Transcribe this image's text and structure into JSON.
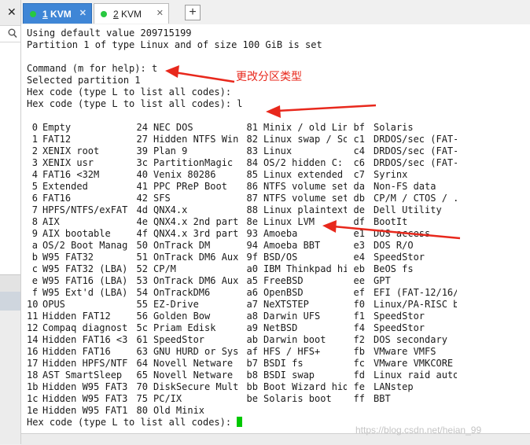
{
  "left_panel": {
    "close_glyph": "✕"
  },
  "tabs": [
    {
      "number": "1",
      "name": "KVM",
      "close_glyph": "✕"
    },
    {
      "number": "2",
      "name": "KVM",
      "close_glyph": "✕"
    }
  ],
  "add_tab_glyph": "+",
  "colors": {
    "active_tab": "#3f86d6",
    "status_dot": "#28c840",
    "cursor": "#00c800",
    "annotation": "#e8281c"
  },
  "terminal": {
    "header_lines": [
      "Using default value 209715199",
      "Partition 1 of type Linux and of size 100 GiB is set",
      "",
      "Command (m for help): t",
      "Selected partition 1",
      "Hex code (type L to list all codes):",
      "Hex code (type L to list all codes): l"
    ],
    "partition_types": [
      [
        "0",
        "Empty",
        "24",
        "NEC DOS",
        "81",
        "Minix / old Lin",
        "bf",
        "Solaris"
      ],
      [
        "1",
        "FAT12",
        "27",
        "Hidden NTFS Win",
        "82",
        "Linux swap / So",
        "c1",
        "DRDOS/sec (FAT-"
      ],
      [
        "2",
        "XENIX root",
        "39",
        "Plan 9",
        "83",
        "Linux",
        "c4",
        "DRDOS/sec (FAT-"
      ],
      [
        "3",
        "XENIX usr",
        "3c",
        "PartitionMagic",
        "84",
        "OS/2 hidden C:",
        "c6",
        "DRDOS/sec (FAT-"
      ],
      [
        "4",
        "FAT16 <32M",
        "40",
        "Venix 80286",
        "85",
        "Linux extended",
        "c7",
        "Syrinx"
      ],
      [
        "5",
        "Extended",
        "41",
        "PPC PReP Boot",
        "86",
        "NTFS volume set",
        "da",
        "Non-FS data"
      ],
      [
        "6",
        "FAT16",
        "42",
        "SFS",
        "87",
        "NTFS volume set",
        "db",
        "CP/M / CTOS / ."
      ],
      [
        "7",
        "HPFS/NTFS/exFAT",
        "4d",
        "QNX4.x",
        "88",
        "Linux plaintext",
        "de",
        "Dell Utility"
      ],
      [
        "8",
        "AIX",
        "4e",
        "QNX4.x 2nd part",
        "8e",
        "Linux LVM",
        "df",
        "BootIt"
      ],
      [
        "9",
        "AIX bootable",
        "4f",
        "QNX4.x 3rd part",
        "93",
        "Amoeba",
        "e1",
        "DOS access"
      ],
      [
        "a",
        "OS/2 Boot Manag",
        "50",
        "OnTrack DM",
        "94",
        "Amoeba BBT",
        "e3",
        "DOS R/O"
      ],
      [
        "b",
        "W95 FAT32",
        "51",
        "OnTrack DM6 Aux",
        "9f",
        "BSD/OS",
        "e4",
        "SpeedStor"
      ],
      [
        "c",
        "W95 FAT32 (LBA)",
        "52",
        "CP/M",
        "a0",
        "IBM Thinkpad hi",
        "eb",
        "BeOS fs"
      ],
      [
        "e",
        "W95 FAT16 (LBA)",
        "53",
        "OnTrack DM6 Aux",
        "a5",
        "FreeBSD",
        "ee",
        "GPT"
      ],
      [
        "f",
        "W95 Ext'd (LBA)",
        "54",
        "OnTrackDM6",
        "a6",
        "OpenBSD",
        "ef",
        "EFI (FAT-12/16/"
      ],
      [
        "10",
        "OPUS",
        "55",
        "EZ-Drive",
        "a7",
        "NeXTSTEP",
        "f0",
        "Linux/PA-RISC b"
      ],
      [
        "11",
        "Hidden FAT12",
        "56",
        "Golden Bow",
        "a8",
        "Darwin UFS",
        "f1",
        "SpeedStor"
      ],
      [
        "12",
        "Compaq diagnost",
        "5c",
        "Priam Edisk",
        "a9",
        "NetBSD",
        "f4",
        "SpeedStor"
      ],
      [
        "14",
        "Hidden FAT16 <3",
        "61",
        "SpeedStor",
        "ab",
        "Darwin boot",
        "f2",
        "DOS secondary"
      ],
      [
        "16",
        "Hidden FAT16",
        "63",
        "GNU HURD or Sys",
        "af",
        "HFS / HFS+",
        "fb",
        "VMware VMFS"
      ],
      [
        "17",
        "Hidden HPFS/NTF",
        "64",
        "Novell Netware",
        "b7",
        "BSDI fs",
        "fc",
        "VMware VMKCORE"
      ],
      [
        "18",
        "AST SmartSleep",
        "65",
        "Novell Netware",
        "b8",
        "BSDI swap",
        "fd",
        "Linux raid auto"
      ],
      [
        "1b",
        "Hidden W95 FAT3",
        "70",
        "DiskSecure Mult",
        "bb",
        "Boot Wizard hid",
        "fe",
        "LANstep"
      ],
      [
        "1c",
        "Hidden W95 FAT3",
        "75",
        "PC/IX",
        "be",
        "Solaris boot",
        "ff",
        "BBT"
      ],
      [
        "1e",
        "Hidden W95 FAT1",
        "80",
        "Old Minix"
      ]
    ],
    "prompt_line": "Hex code (type L to list all codes): "
  },
  "annotation_text": "更改分区类型",
  "watermark_text": "https://blog.csdn.net/heian_99"
}
